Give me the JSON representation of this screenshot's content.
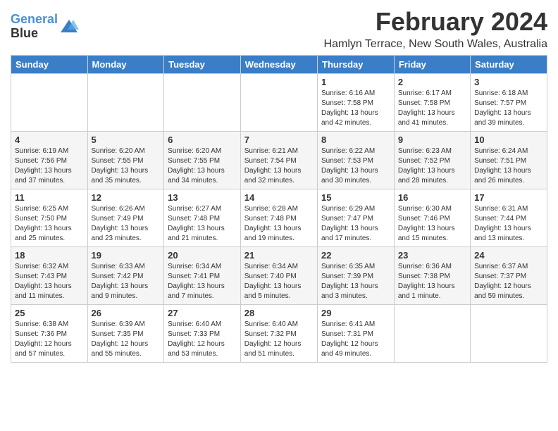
{
  "header": {
    "logo_line1": "General",
    "logo_line2": "Blue",
    "title": "February 2024",
    "subtitle": "Hamlyn Terrace, New South Wales, Australia"
  },
  "days_of_week": [
    "Sunday",
    "Monday",
    "Tuesday",
    "Wednesday",
    "Thursday",
    "Friday",
    "Saturday"
  ],
  "weeks": [
    [
      {
        "day": "",
        "info": ""
      },
      {
        "day": "",
        "info": ""
      },
      {
        "day": "",
        "info": ""
      },
      {
        "day": "",
        "info": ""
      },
      {
        "day": "1",
        "info": "Sunrise: 6:16 AM\nSunset: 7:58 PM\nDaylight: 13 hours\nand 42 minutes."
      },
      {
        "day": "2",
        "info": "Sunrise: 6:17 AM\nSunset: 7:58 PM\nDaylight: 13 hours\nand 41 minutes."
      },
      {
        "day": "3",
        "info": "Sunrise: 6:18 AM\nSunset: 7:57 PM\nDaylight: 13 hours\nand 39 minutes."
      }
    ],
    [
      {
        "day": "4",
        "info": "Sunrise: 6:19 AM\nSunset: 7:56 PM\nDaylight: 13 hours\nand 37 minutes."
      },
      {
        "day": "5",
        "info": "Sunrise: 6:20 AM\nSunset: 7:55 PM\nDaylight: 13 hours\nand 35 minutes."
      },
      {
        "day": "6",
        "info": "Sunrise: 6:20 AM\nSunset: 7:55 PM\nDaylight: 13 hours\nand 34 minutes."
      },
      {
        "day": "7",
        "info": "Sunrise: 6:21 AM\nSunset: 7:54 PM\nDaylight: 13 hours\nand 32 minutes."
      },
      {
        "day": "8",
        "info": "Sunrise: 6:22 AM\nSunset: 7:53 PM\nDaylight: 13 hours\nand 30 minutes."
      },
      {
        "day": "9",
        "info": "Sunrise: 6:23 AM\nSunset: 7:52 PM\nDaylight: 13 hours\nand 28 minutes."
      },
      {
        "day": "10",
        "info": "Sunrise: 6:24 AM\nSunset: 7:51 PM\nDaylight: 13 hours\nand 26 minutes."
      }
    ],
    [
      {
        "day": "11",
        "info": "Sunrise: 6:25 AM\nSunset: 7:50 PM\nDaylight: 13 hours\nand 25 minutes."
      },
      {
        "day": "12",
        "info": "Sunrise: 6:26 AM\nSunset: 7:49 PM\nDaylight: 13 hours\nand 23 minutes."
      },
      {
        "day": "13",
        "info": "Sunrise: 6:27 AM\nSunset: 7:48 PM\nDaylight: 13 hours\nand 21 minutes."
      },
      {
        "day": "14",
        "info": "Sunrise: 6:28 AM\nSunset: 7:48 PM\nDaylight: 13 hours\nand 19 minutes."
      },
      {
        "day": "15",
        "info": "Sunrise: 6:29 AM\nSunset: 7:47 PM\nDaylight: 13 hours\nand 17 minutes."
      },
      {
        "day": "16",
        "info": "Sunrise: 6:30 AM\nSunset: 7:46 PM\nDaylight: 13 hours\nand 15 minutes."
      },
      {
        "day": "17",
        "info": "Sunrise: 6:31 AM\nSunset: 7:44 PM\nDaylight: 13 hours\nand 13 minutes."
      }
    ],
    [
      {
        "day": "18",
        "info": "Sunrise: 6:32 AM\nSunset: 7:43 PM\nDaylight: 13 hours\nand 11 minutes."
      },
      {
        "day": "19",
        "info": "Sunrise: 6:33 AM\nSunset: 7:42 PM\nDaylight: 13 hours\nand 9 minutes."
      },
      {
        "day": "20",
        "info": "Sunrise: 6:34 AM\nSunset: 7:41 PM\nDaylight: 13 hours\nand 7 minutes."
      },
      {
        "day": "21",
        "info": "Sunrise: 6:34 AM\nSunset: 7:40 PM\nDaylight: 13 hours\nand 5 minutes."
      },
      {
        "day": "22",
        "info": "Sunrise: 6:35 AM\nSunset: 7:39 PM\nDaylight: 13 hours\nand 3 minutes."
      },
      {
        "day": "23",
        "info": "Sunrise: 6:36 AM\nSunset: 7:38 PM\nDaylight: 13 hours\nand 1 minute."
      },
      {
        "day": "24",
        "info": "Sunrise: 6:37 AM\nSunset: 7:37 PM\nDaylight: 12 hours\nand 59 minutes."
      }
    ],
    [
      {
        "day": "25",
        "info": "Sunrise: 6:38 AM\nSunset: 7:36 PM\nDaylight: 12 hours\nand 57 minutes."
      },
      {
        "day": "26",
        "info": "Sunrise: 6:39 AM\nSunset: 7:35 PM\nDaylight: 12 hours\nand 55 minutes."
      },
      {
        "day": "27",
        "info": "Sunrise: 6:40 AM\nSunset: 7:33 PM\nDaylight: 12 hours\nand 53 minutes."
      },
      {
        "day": "28",
        "info": "Sunrise: 6:40 AM\nSunset: 7:32 PM\nDaylight: 12 hours\nand 51 minutes."
      },
      {
        "day": "29",
        "info": "Sunrise: 6:41 AM\nSunset: 7:31 PM\nDaylight: 12 hours\nand 49 minutes."
      },
      {
        "day": "",
        "info": ""
      },
      {
        "day": "",
        "info": ""
      }
    ]
  ]
}
